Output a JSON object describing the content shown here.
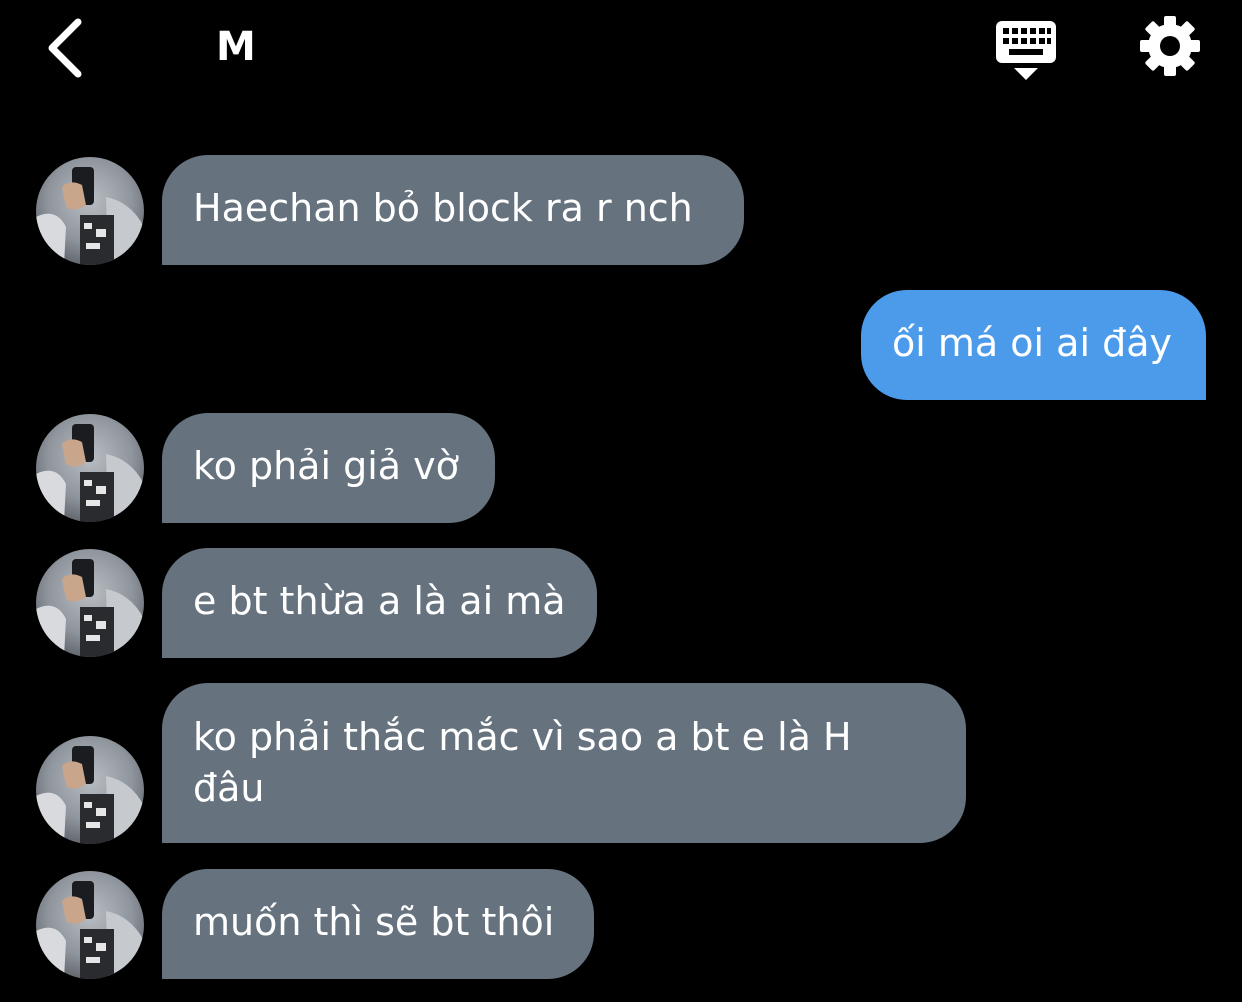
{
  "header": {
    "title": "M",
    "back_icon": "chevron-left-icon",
    "keyboard_icon": "keyboard-icon",
    "settings_icon": "gear-icon"
  },
  "colors": {
    "background": "#000000",
    "incoming_bubble": "#66737f",
    "outgoing_bubble": "#4c9beb",
    "text": "#ffffff"
  },
  "messages": [
    {
      "direction": "incoming",
      "text": "Haechan bỏ block ra r nch"
    },
    {
      "direction": "outgoing",
      "text": "ối má oi ai đây"
    },
    {
      "direction": "incoming",
      "text": "ko phải giả vờ"
    },
    {
      "direction": "incoming",
      "text": "e bt thừa a là ai mà"
    },
    {
      "direction": "incoming",
      "text": "ko phải thắc mắc vì sao a bt e là H đâu"
    },
    {
      "direction": "incoming",
      "text": "muốn thì sẽ bt thôi"
    }
  ]
}
